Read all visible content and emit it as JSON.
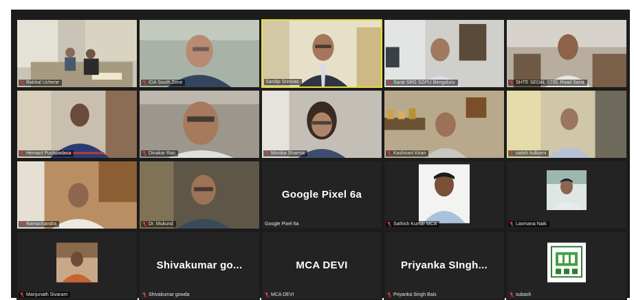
{
  "meeting": {
    "participants": [
      {
        "name": "Rakhal Uchene",
        "view": "video",
        "muted": true
      },
      {
        "name": "IDA South Zone",
        "view": "video",
        "muted": true
      },
      {
        "name": "Sandip Srinivas",
        "view": "video",
        "muted": false,
        "active_speaker": true
      },
      {
        "name": "Sarat SRG SGPU Bengaluru",
        "view": "video",
        "muted": true
      },
      {
        "name": "SHTE SEDAL STEL Road Sarat",
        "view": "video",
        "muted": true
      },
      {
        "name": "Hemant Pushpadasa",
        "view": "video",
        "muted": true
      },
      {
        "name": "Dinakar Rao",
        "view": "video",
        "muted": true
      },
      {
        "name": "Monika Sharma",
        "view": "video",
        "muted": true
      },
      {
        "name": "Kashirani Kiran",
        "view": "video",
        "muted": true
      },
      {
        "name": "satish kulkarni",
        "view": "video",
        "muted": true
      },
      {
        "name": "Ramachandra",
        "view": "video",
        "muted": true
      },
      {
        "name": "Dr. Mukund",
        "view": "video",
        "muted": true
      },
      {
        "name": "Google Pixel 6a",
        "display_label": "Google Pixel 6a",
        "view": "name",
        "muted": true
      },
      {
        "name": "Sathish Kumar MCA",
        "view": "photo",
        "muted": true
      },
      {
        "name": "Laxmana Naik",
        "view": "photo",
        "muted": true
      },
      {
        "name": "Manjunath Sivaram",
        "view": "photo",
        "muted": true
      },
      {
        "name": "Shivakumar gowda",
        "display_label": "Shivakumar go...",
        "view": "name",
        "muted": true
      },
      {
        "name": "MCA DEVI",
        "display_label": "MCA DEVI",
        "view": "name",
        "muted": true
      },
      {
        "name": "Priyanka Singh Bais",
        "display_label": "Priyanka SIngh...",
        "view": "name",
        "muted": true
      },
      {
        "name": "subash",
        "view": "logo",
        "muted": true
      }
    ]
  },
  "colors": {
    "stage_bg": "#1c1c1c",
    "tile_bg": "#232323",
    "active_speaker_border": "#e4de3c",
    "muted_mic": "#e53935"
  }
}
